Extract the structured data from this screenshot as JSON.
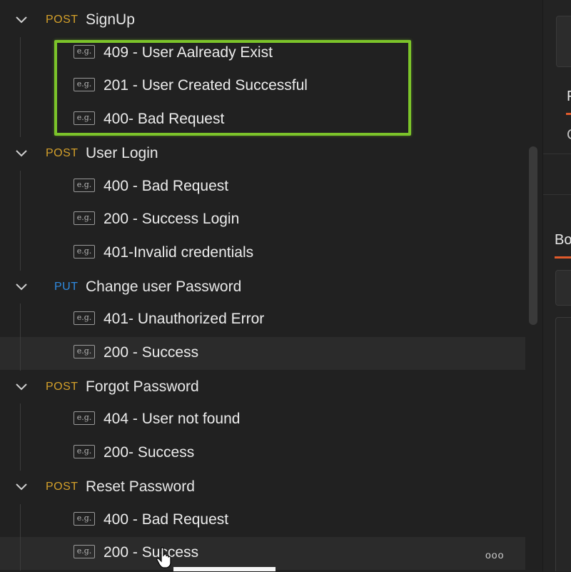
{
  "sidebar": {
    "requests": [
      {
        "method": "POST",
        "name": "SignUp",
        "examples": [
          "409 - User Aalready Exist",
          "201 - User Created Successful",
          "400- Bad Request"
        ]
      },
      {
        "method": "POST",
        "name": "User Login",
        "examples": [
          "400 - Bad Request",
          "200 - Success Login",
          "401-Invalid credentials"
        ]
      },
      {
        "method": "PUT",
        "name": "Change user Password",
        "examples": [
          "401- Unauthorized Error",
          "200 - Success"
        ]
      },
      {
        "method": "POST",
        "name": "Forgot Password",
        "examples": [
          "404 - User not found",
          "200- Success"
        ]
      },
      {
        "method": "POST",
        "name": "Reset Password",
        "examples": [
          "400 - Bad Request",
          "200 - Success"
        ]
      }
    ],
    "example_badge": "e.g.",
    "more_actions": "ooo"
  },
  "right_panel": {
    "tab_partial_1": "P",
    "tab_partial_2": "C",
    "body_tab_partial": "Bo"
  },
  "colors": {
    "post_method": "#d4a02a",
    "put_method": "#2f8ae0",
    "highlight_box": "#7cc42a",
    "active_tab_underline": "#e05a2b"
  }
}
